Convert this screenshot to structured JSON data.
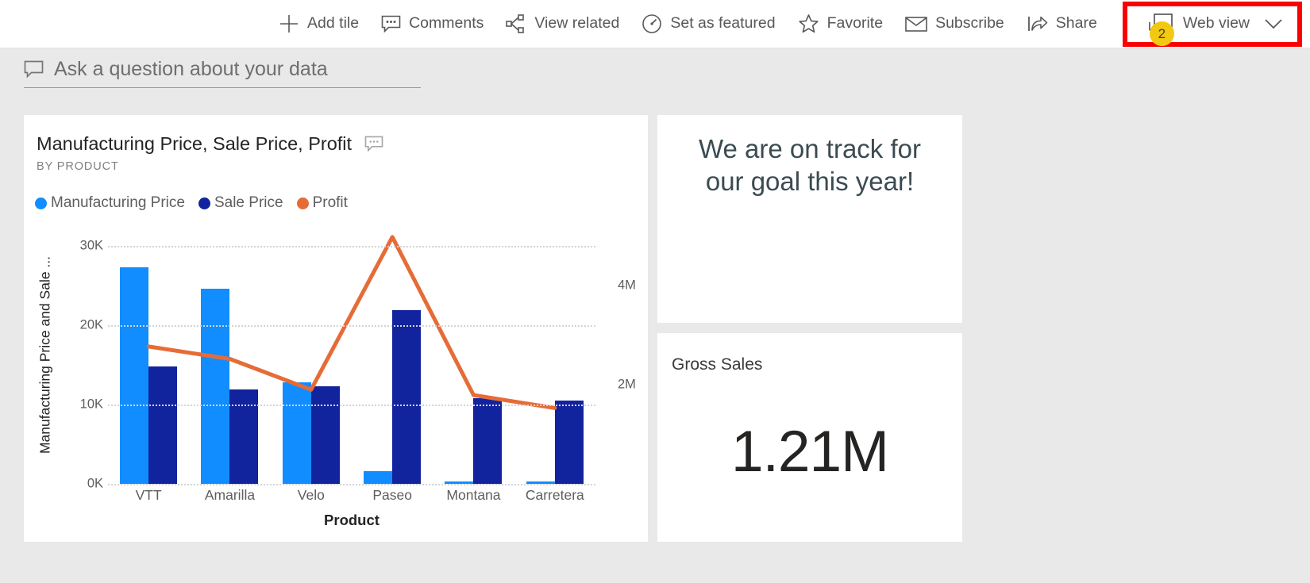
{
  "toolbar": {
    "items": [
      {
        "label": "Add tile",
        "icon": "plus-icon",
        "name": "add-tile"
      },
      {
        "label": "Comments",
        "icon": "comment-icon",
        "name": "comments"
      },
      {
        "label": "View related",
        "icon": "share-nodes-icon",
        "name": "view-related"
      },
      {
        "label": "Set as featured",
        "icon": "gauge-icon",
        "name": "set-as-featured"
      },
      {
        "label": "Favorite",
        "icon": "star-icon",
        "name": "favorite"
      },
      {
        "label": "Subscribe",
        "icon": "envelope-icon",
        "name": "subscribe"
      },
      {
        "label": "Share",
        "icon": "share-arrow-icon",
        "name": "share"
      }
    ],
    "web_view": {
      "label": "Web view",
      "badge": "2",
      "icon": "monitor-icon",
      "chevron": "chevron-down-icon",
      "highlight_color": "#fa0000",
      "badge_color": "#f2c811"
    }
  },
  "qna": {
    "placeholder": "Ask a question about your data",
    "icon": "speech-bubble-icon"
  },
  "tiles": {
    "text_tile": {
      "line1": "We are on track for",
      "line2": "our goal this year!"
    },
    "kpi_tile": {
      "title": "Gross Sales",
      "value": "1.21M"
    },
    "chart_tile": {
      "title": "Manufacturing Price, Sale Price, Profit",
      "subtitle": "BY PRODUCT",
      "comment_icon": "comment-icon"
    }
  },
  "chart_data": {
    "type": "bar",
    "title": "Manufacturing Price, Sale Price, Profit",
    "subtitle": "BY PRODUCT",
    "xlabel": "Product",
    "ylabel": "Manufacturing Price and Sale ...",
    "y2label": "",
    "categories": [
      "VTT",
      "Amarilla",
      "Velo",
      "Paseo",
      "Montana",
      "Carretera"
    ],
    "grid": true,
    "legend_position": "top-left",
    "ylim": [
      0,
      33000
    ],
    "yticks": [
      "0K",
      "10K",
      "20K",
      "30K"
    ],
    "ytick_values": [
      0,
      10000,
      20000,
      30000
    ],
    "y2lim": [
      0,
      5280000
    ],
    "y2ticks": [
      "2M",
      "4M"
    ],
    "y2tick_values": [
      2000000,
      4000000
    ],
    "series": [
      {
        "name": "Manufacturing Price",
        "type": "bar",
        "color": "#118DFF",
        "axis": "left",
        "values": [
          27300,
          24600,
          12800,
          1600,
          330,
          260
        ]
      },
      {
        "name": "Sale Price",
        "type": "bar",
        "color": "#12239E",
        "axis": "left",
        "values": [
          14800,
          11900,
          12300,
          21900,
          10800,
          10500
        ]
      },
      {
        "name": "Profit",
        "type": "line",
        "color": "#E66C37",
        "axis": "right",
        "values": [
          2770000,
          2520000,
          1900000,
          4980000,
          1790000,
          1530000
        ]
      }
    ]
  }
}
